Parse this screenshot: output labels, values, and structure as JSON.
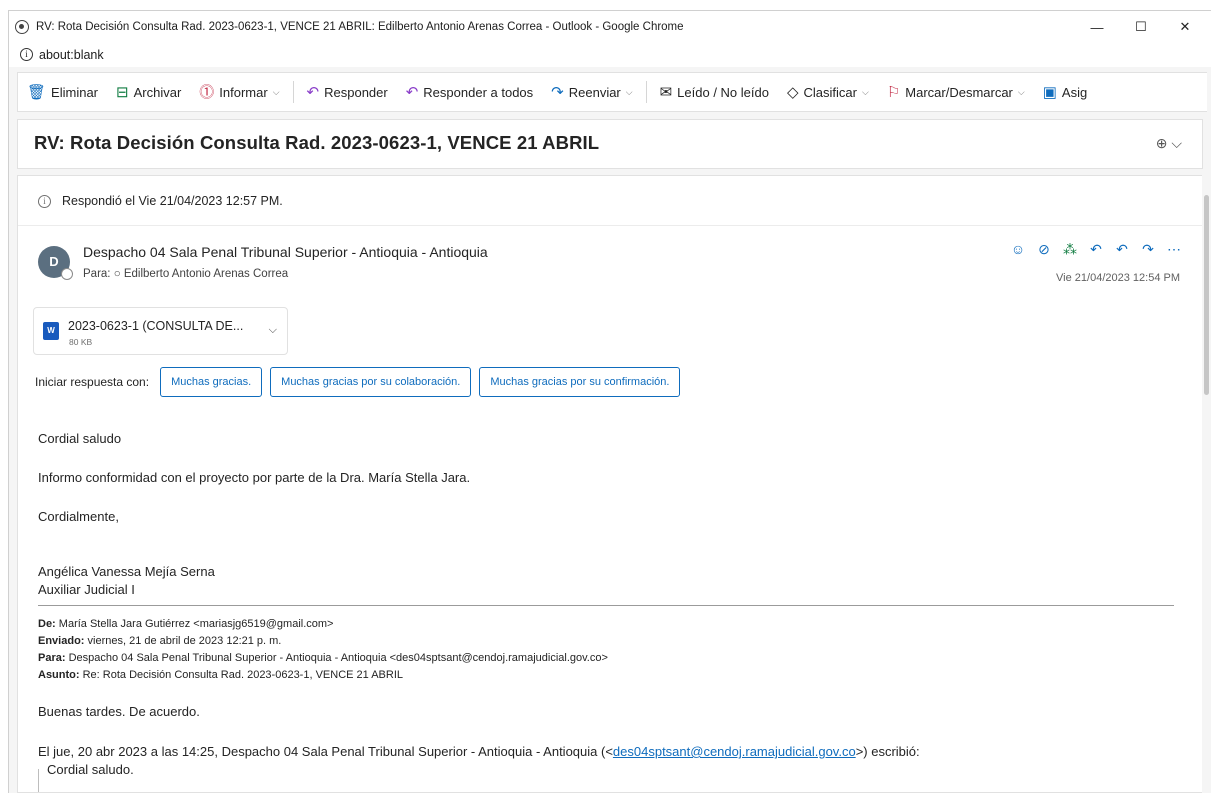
{
  "window": {
    "title": "RV: Rota Decisión Consulta Rad. 2023-0623-1, VENCE 21 ABRIL: Edilberto Antonio Arenas Correa - Outlook - Google Chrome",
    "minimize": "—",
    "maximize": "☐",
    "close": "✕"
  },
  "address": {
    "url": "about:blank"
  },
  "toolbar": {
    "items": [
      {
        "label": "Eliminar",
        "icon": "🗑"
      },
      {
        "label": "Archivar",
        "icon": "🗃"
      },
      {
        "label": "Informar",
        "icon": "⓵"
      },
      {
        "label": "Responder",
        "icon": "↶"
      },
      {
        "label": "Responder a todos",
        "icon": "↶"
      },
      {
        "label": "Reenviar",
        "icon": "↷"
      },
      {
        "label": "Leído / No leído",
        "icon": "✉"
      },
      {
        "label": "Clasificar",
        "icon": "◇"
      },
      {
        "label": "Marcar/Desmarcar",
        "icon": "⚐"
      },
      {
        "label": "Asig",
        "icon": "▣"
      }
    ]
  },
  "subject": "RV: Rota Decisión Consulta Rad. 2023-0623-1, VENCE 21 ABRIL",
  "replied_notice": "Respondió el Vie 21/04/2023 12:57 PM.",
  "message": {
    "avatar_initial": "D",
    "sender": "Despacho 04 Sala Penal Tribunal Superior - Antioquia - Antioquia",
    "to_label": "Para:",
    "to_name": "Edilberto Antonio Arenas Correa",
    "date": "Vie 21/04/2023 12:54 PM"
  },
  "attachment": {
    "name": "2023-0623-1 (CONSULTA DE...",
    "size": "80 KB"
  },
  "quick_replies": {
    "label": "Iniciar respuesta con:",
    "options": [
      "Muchas gracias.",
      "Muchas gracias por su colaboración.",
      "Muchas gracias por su confirmación."
    ]
  },
  "body": {
    "greeting": "Cordial saludo",
    "line1": "Informo conformidad con el proyecto por parte de la Dra. María Stella Jara.",
    "closing": "Cordialmente,",
    "sig_name": "Angélica Vanessa Mejía Serna",
    "sig_title": "Auxiliar Judicial I"
  },
  "forwarded": {
    "de_label": "De:",
    "de_value": "María Stella Jara Gutiérrez <mariasjg6519@gmail.com>",
    "enviado_label": "Enviado:",
    "enviado_value": "viernes, 21 de abril de 2023 12:21 p. m.",
    "para_label": "Para:",
    "para_value": "Despacho 04 Sala Penal Tribunal Superior - Antioquia - Antioquia <des04sptsant@cendoj.ramajudicial.gov.co>",
    "asunto_label": "Asunto:",
    "asunto_value": "Re: Rota Decisión Consulta Rad. 2023-0623-1, VENCE 21 ABRIL",
    "reply_text": "Buenas tardes. De acuerdo.",
    "quote_intro_before": "El jue, 20 abr 2023 a las 14:25, Despacho 04 Sala Penal Tribunal Superior - Antioquia - Antioquia (<",
    "quote_email": "des04sptsant@cendoj.ramajudicial.gov.co",
    "quote_intro_after": ">) escribió:",
    "quote_greeting": "Cordial saludo."
  },
  "colors": {
    "accent": "#0f6cbd",
    "archive_green": "#107c41",
    "flag_red": "#c4314b"
  }
}
